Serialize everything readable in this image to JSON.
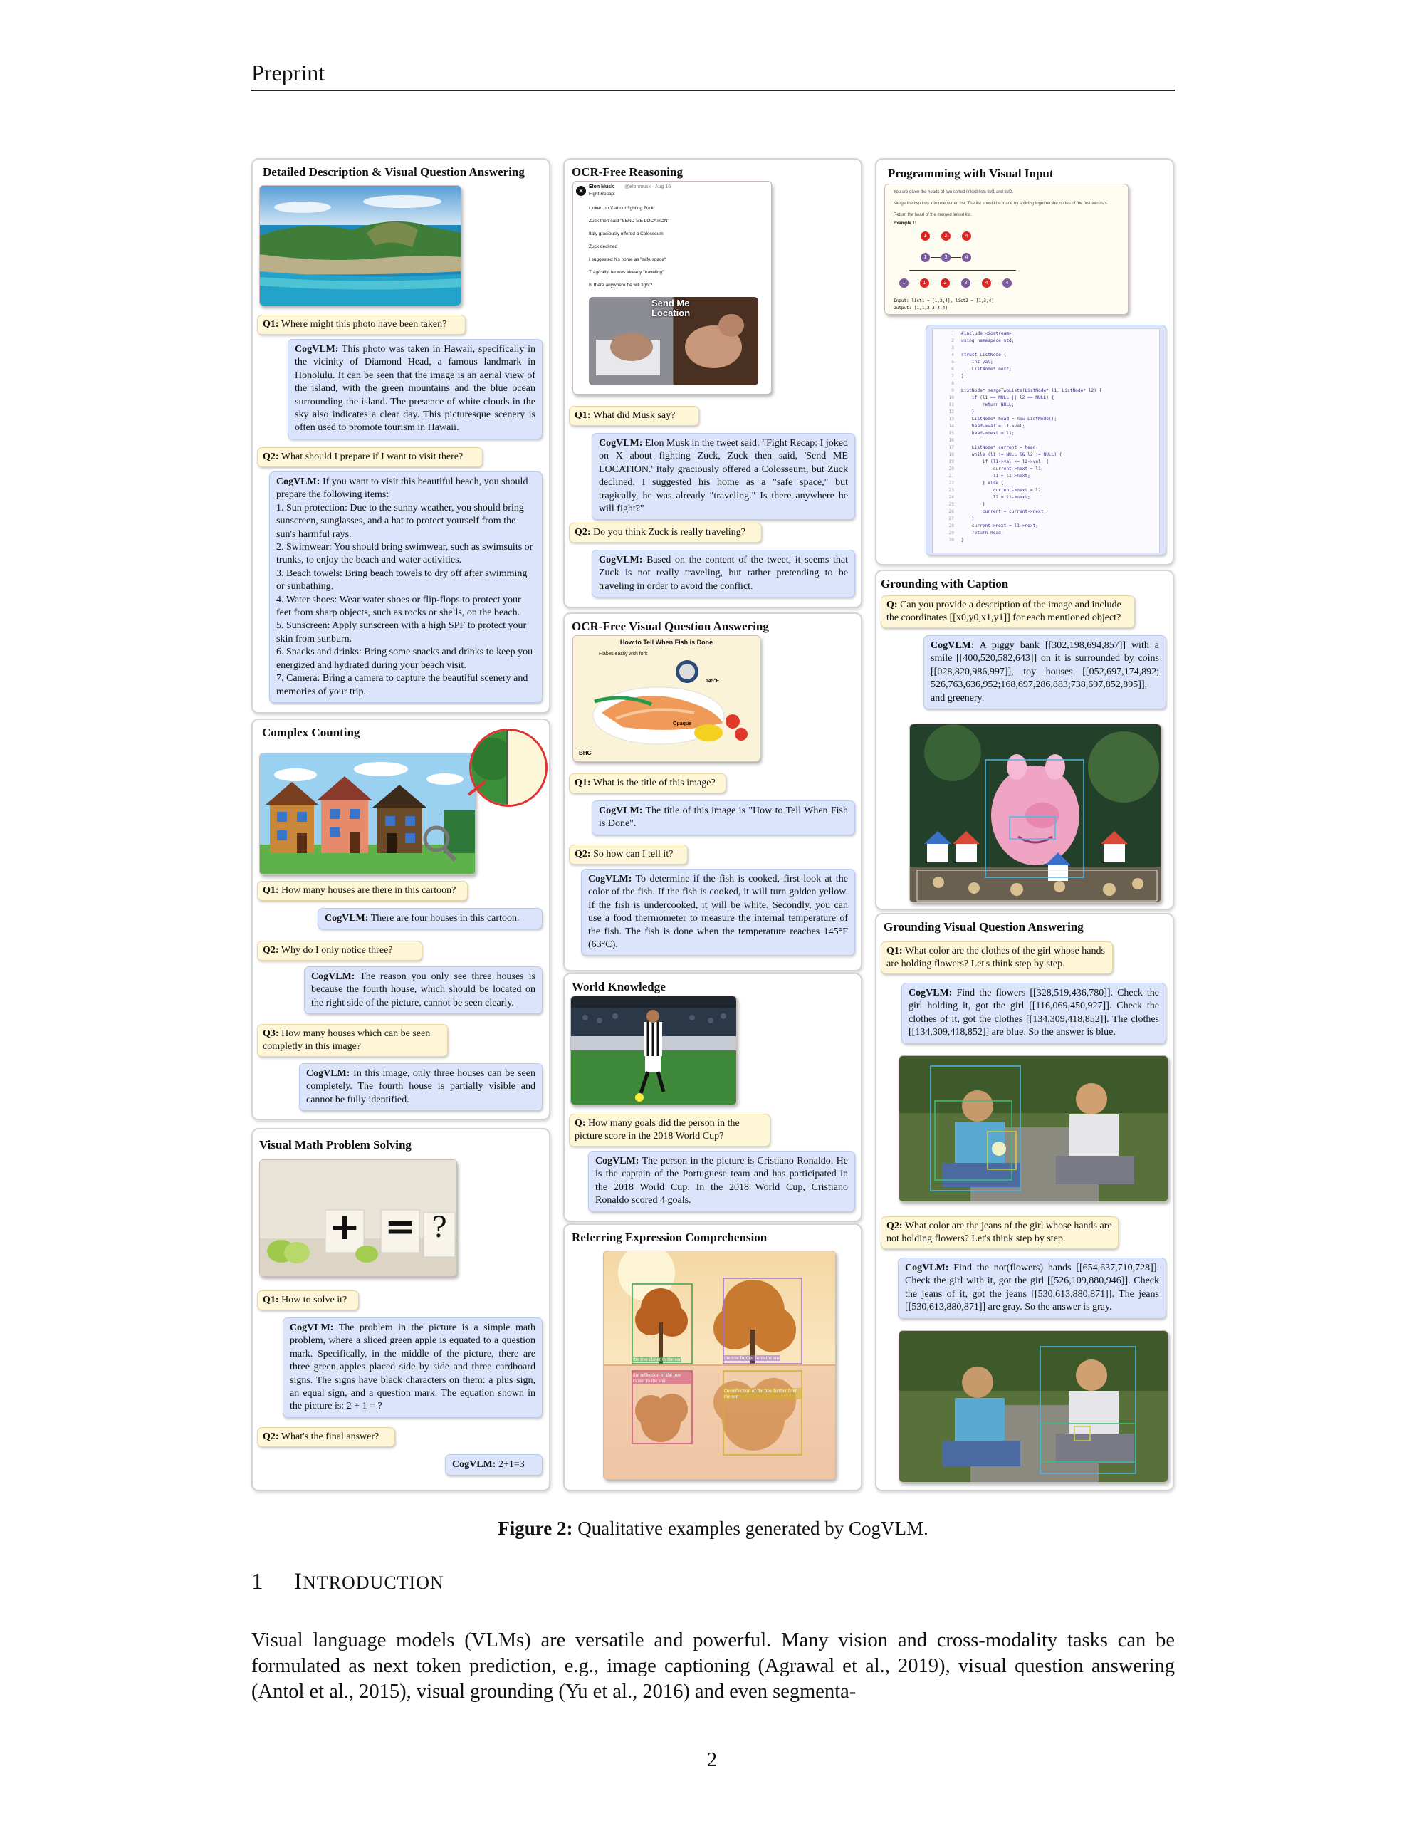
{
  "header": "Preprint",
  "panels": {
    "detailed": {
      "title": "Detailed Description & Visual Question Answering",
      "q1": "Where might this photo have been taken?",
      "a1": "This photo was taken in Hawaii, specifically in the vicinity of Diamond Head, a famous landmark in Honolulu. It can be seen that the image is an aerial view of the island, with the green mountains and the blue ocean surrounding the island. The presence of white clouds in the sky also indicates a clear day. This picturesque scenery is often used to promote tourism in Hawaii.",
      "q2": "What should I prepare if I want to visit there?",
      "a2_intro": "If you want to visit this beautiful beach, you should prepare the following items:",
      "a2_items": [
        "1. Sun protection: Due to the sunny weather, you should bring sunscreen, sunglasses, and a hat to protect yourself from the sun's harmful rays.",
        "2. Swimwear: You should bring swimwear, such as swimsuits or trunks, to enjoy the beach and water activities.",
        "3. Beach towels: Bring beach towels to dry off after swimming or sunbathing.",
        "4. Water shoes: Wear water shoes or flip-flops to protect your feet from sharp objects, such as rocks or shells, on the beach.",
        "5. Sunscreen: Apply sunscreen with a high SPF to protect your skin from sunburn.",
        "6. Snacks and drinks: Bring some snacks and drinks to keep you energized and hydrated during your beach visit.",
        "7. Camera: Bring a camera to capture the beautiful scenery and memories of your trip."
      ]
    },
    "counting": {
      "title": "Complex Counting",
      "q1": "How many houses are there in this cartoon?",
      "a1": "There are four houses in this cartoon.",
      "q2": "Why do I only notice three?",
      "a2": "The reason you only see three houses is because the fourth house, which should be located on the right side of the picture, cannot be seen clearly.",
      "q3": "How many houses which can be seen completly in this image?",
      "a3": "In this image, only three houses can be seen completely. The fourth house is partially visible and cannot be fully identified."
    },
    "math": {
      "title": "Visual Math Problem Solving",
      "q1": "How to solve it?",
      "a1": "The problem in the picture is a simple math problem, where a sliced green apple is equated to a question mark. Specifically, in the middle of the picture, there are three green apples placed side by side and three cardboard signs. The signs have black characters on them: a plus sign, an equal sign, and a question mark. The equation shown in the picture is: 2 + 1 = ?",
      "q2": "What's the final answer?",
      "a2": "2+1=3",
      "img_plus": "+",
      "img_eq": "=",
      "img_q": "?"
    },
    "ocr": {
      "title": "OCR-Free Reasoning",
      "tweet_user": "Elon Musk",
      "tweet_handle": "@elonmusk · Aug 16",
      "tweet_lines": [
        "Fight Recap:",
        "I joked on X about fighting Zuck",
        "Zuck then said \"SEND ME LOCATION\"",
        "Italy graciously offered a Colosseum",
        "Zuck declined",
        "I suggested his home as \"safe space\"",
        "Tragically, he was already \"traveling\"",
        "Is there anywhere he will fight?"
      ],
      "tweet_overlay": "Send Me Location",
      "q1": "What did Musk say?",
      "a1": "Elon Musk in the tweet said: \"Fight Recap: I joked on X about fighting Zuck, Zuck then said, 'Send ME LOCATION.' Italy graciously offered a Colosseum, but Zuck declined. I suggested his home as a \"safe space,\" but tragically, he was already \"traveling.\" Is there anywhere he will fight?\"",
      "q2": "Do you think Zuck is really traveling?",
      "a2": "Based on the content of the tweet, it seems that Zuck is not really traveling, but rather pretending to be traveling in order to avoid the conflict."
    },
    "ocrvqa": {
      "title": "OCR-Free Visual Question Answering",
      "img_title": "How to Tell When Fish is Done",
      "img_flakes": "Flakes easily with fork",
      "img_temp": "145°F",
      "img_opaque": "Opaque",
      "img_brand": "BHG",
      "q1": "What is the title of this image?",
      "a1": "The title of this image is \"How to Tell When Fish is Done\".",
      "q2": "So how can I tell it?",
      "a2": "To determine if the fish is cooked, first look at the color of the fish. If the fish is cooked, it will turn golden yellow. If the fish is undercooked, it will be white. Secondly, you can use a food thermometer to measure the internal temperature of the fish. The fish is done when the temperature reaches 145°F (63°C)."
    },
    "world": {
      "title": "World Knowledge",
      "q1": "How many goals did the person in the picture score in the 2018 World Cup?",
      "a1": "The person in the picture is Cristiano Ronaldo. He is the captain of the Portuguese team and has participated in the 2018 World Cup. In the 2018 World Cup, Cristiano Ronaldo scored 4 goals."
    },
    "rec": {
      "title": "Referring Expression Comprehension",
      "labels": [
        "the tree closer to the sun",
        "the tree further from the sun",
        "the reflection of the tree closer to the sun",
        "the reflection of the tree further from the sun"
      ]
    },
    "prog": {
      "title": "Programming with Visual Input",
      "problem_lines": [
        "You are given the heads of two sorted linked lists list1 and list2.",
        "Merge the two lists into one sorted list. The list should be made by splicing together the nodes of the first two lists.",
        "Return the head of the merged linked list.",
        "Example 1:"
      ],
      "list1": [
        "1",
        "2",
        "4"
      ],
      "list2": [
        "1",
        "3",
        "4"
      ],
      "merged": [
        "1",
        "1",
        "2",
        "3",
        "4",
        "4"
      ],
      "input_line": "Input: list1 = [1,2,4], list2 = [1,3,4]",
      "output_line": "Output: [1,1,2,3,4,4]",
      "code_lines": [
        "#include <iostream>",
        "using namespace std;",
        "",
        "struct ListNode {",
        "    int val;",
        "    ListNode* next;",
        "};",
        "",
        "ListNode* mergeTwoLists(ListNode* l1, ListNode* l2) {",
        "    if (l1 == NULL || l2 == NULL) {",
        "        return NULL;",
        "    }",
        "    ListNode* head = new ListNode();",
        "    head->val = l1->val;",
        "    head->next = l1;",
        "",
        "    ListNode* current = head;",
        "    while (l1 != NULL && l2 != NULL) {",
        "        if (l1->val <= l2->val) {",
        "            current->next = l1;",
        "            l1 = l1->next;",
        "        } else {",
        "            current->next = l2;",
        "            l2 = l2->next;",
        "        }",
        "        current = current->next;",
        "    }",
        "    current->next = l1->next;",
        "    return head;",
        "}"
      ]
    },
    "grounding": {
      "title": "Grounding with Caption",
      "q1": "Can you provide a description of the image and include the coordinates [[x0,y0,x1,y1]] for each mentioned object?",
      "a1": "A piggy bank [[302,198,694,857]] with a smile [[400,520,582,643]] on it is surrounded by coins [[028,820,986,997]], toy houses [[052,697,174,892; 526,763,636,952;168,697,286,883;738,697,852,895]], and greenery."
    },
    "gvqa": {
      "title": "Grounding Visual Question Answering",
      "q1": "What color are the clothes of the girl whose hands are holding flowers? Let's think step by step.",
      "a1": "Find the flowers [[328,519,436,780]]. Check the girl holding it, got the girl [[116,069,450,927]]. Check the clothes of it, got the clothes [[134,309,418,852]]. The clothes [[134,309,418,852]] are blue. So the answer is blue.",
      "q2": "What color are the jeans of the girl whose hands are not holding flowers? Let's think step by step.",
      "a2": "Find the not(flowers) hands [[654,637,710,728]]. Check the girl with it, got the girl [[526,109,880,946]]. Check the jeans of it, got the jeans [[530,613,880,871]]. The jeans [[530,613,880,871]] are gray. So the answer is gray."
    }
  },
  "labels": {
    "q1": "Q1:",
    "q2": "Q2:",
    "q3": "Q3:",
    "q": "Q:",
    "cog": "CogVLM:"
  },
  "caption": {
    "label": "Figure 2:",
    "text": " Qualitative examples generated by CogVLM."
  },
  "section": {
    "number": "1",
    "first": "I",
    "rest": "NTRODUCTION"
  },
  "body": "Visual language models (VLMs) are versatile and powerful. Many vision and cross-modality tasks can be formulated as next token prediction, e.g., image captioning (Agrawal et al., 2019), visual question answering (Antol et al., 2015), visual grounding (Yu et al., 2016) and even segmenta-",
  "page_number": "2"
}
